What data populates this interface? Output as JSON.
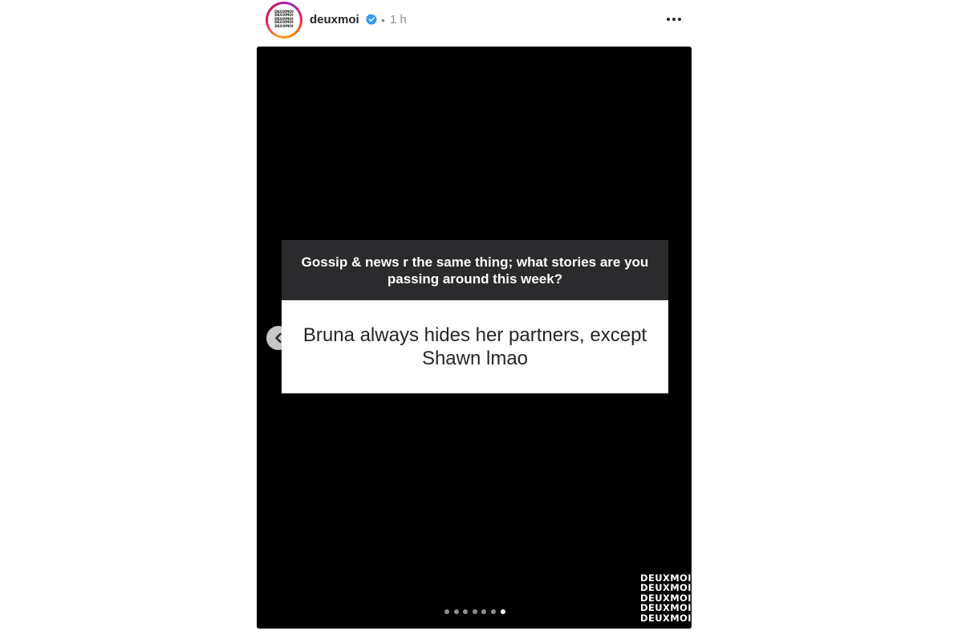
{
  "post": {
    "username": "deuxmoi",
    "separator": "•",
    "time": "1 h",
    "verified_color": "#3897f0"
  },
  "avatar": {
    "logo_lines": [
      "DEUXMOI",
      "DEUXMOI",
      "DEUXMOI",
      "DEUXMOI",
      "DEUXMOI"
    ]
  },
  "story": {
    "question": "Gossip & news r the same thing; what stories are you passing around this week?",
    "answer": "Bruna always hides her partners, except Shawn lmao",
    "watermark_lines": [
      "DEUXMOI",
      "DEUXMOI",
      "DEUXMOI",
      "DEUXMOI",
      "DEUXMOI"
    ]
  },
  "carousel": {
    "total": 7,
    "active_index": 6
  },
  "icons": {
    "more": "more-options-icon",
    "verified": "verified-badge-icon",
    "prev": "chevron-left-icon"
  }
}
